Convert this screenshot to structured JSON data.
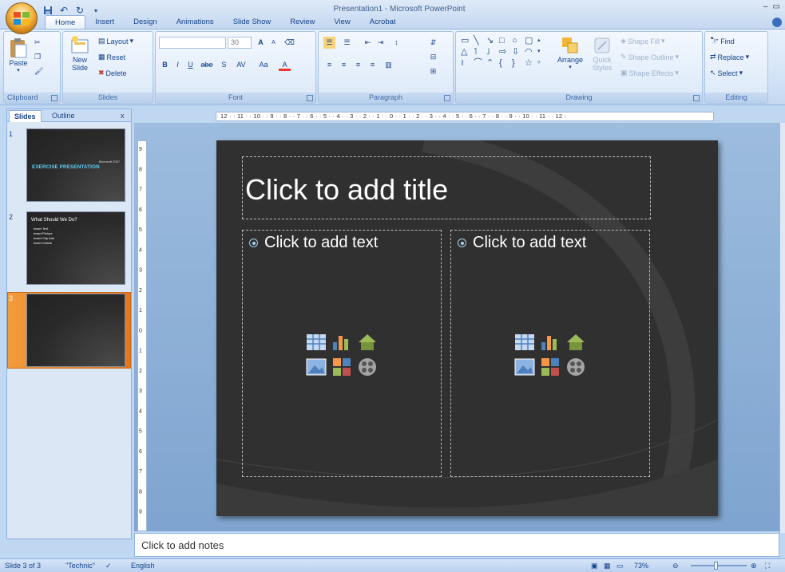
{
  "app": {
    "title": "Presentation1 - Microsoft PowerPoint"
  },
  "qat": {
    "save_icon": "save-icon",
    "undo_icon": "undo-icon",
    "redo_icon": "redo-icon",
    "customize_icon": "customize-qat-icon"
  },
  "tabs": [
    {
      "label": "Home"
    },
    {
      "label": "Insert"
    },
    {
      "label": "Design"
    },
    {
      "label": "Animations"
    },
    {
      "label": "Slide Show"
    },
    {
      "label": "Review"
    },
    {
      "label": "View"
    },
    {
      "label": "Acrobat"
    }
  ],
  "ribbon": {
    "clipboard": {
      "label": "Clipboard",
      "paste": "Paste"
    },
    "slides": {
      "label": "Slides",
      "new_slide": "New Slide",
      "new_slide_line1": "New",
      "new_slide_line2": "Slide",
      "layout": "Layout",
      "reset": "Reset",
      "delete": "Delete"
    },
    "font": {
      "label": "Font",
      "size": "30",
      "grow": "A",
      "shrink": "A",
      "bold": "B",
      "italic": "I",
      "underline": "U",
      "strike": "abe",
      "shadow": "S",
      "spacing": "AV",
      "case": "Aa",
      "color": "A"
    },
    "paragraph": {
      "label": "Paragraph"
    },
    "drawing": {
      "label": "Drawing",
      "arrange": "Arrange",
      "quick_styles": "Quick Styles",
      "quick_line1": "Quick",
      "quick_line2": "Styles",
      "shape_fill": "Shape Fill",
      "shape_outline": "Shape Outline",
      "shape_effects": "Shape Effects"
    },
    "editing": {
      "label": "Editing",
      "find": "Find",
      "replace": "Replace",
      "select": "Select"
    }
  },
  "left_pane": {
    "tabs": [
      {
        "label": "Slides"
      },
      {
        "label": "Outline"
      }
    ],
    "close": "x",
    "slides": [
      {
        "number": "1",
        "title": "EXERCISE PRESENTATION",
        "subtitle": "Microsoft 2007"
      },
      {
        "number": "2",
        "title": "What Should We Do?",
        "bullets": [
          "Insert Text",
          "Insert Picture",
          "Insert Clip Arts",
          "Insert Charts"
        ]
      },
      {
        "number": "3",
        "title": ""
      }
    ]
  },
  "ruler": {
    "horizontal": "· 12 · · 11 · · 10 · · 9 · · 8 · · 7 · · 6 · · 5 · · 4 · · 3 · · 2 · · 1 · · 0 · · 1 · · 2 · · 3 · · 4 · · 5 · · 6 · · 7 · · 8 · · 9 · · 10 · · 11 · · 12 ·",
    "vertical_ticks": [
      "9",
      "8",
      "7",
      "6",
      "5",
      "4",
      "3",
      "2",
      "1",
      "0",
      "1",
      "2",
      "3",
      "4",
      "5",
      "6",
      "7",
      "8",
      "9"
    ]
  },
  "slide": {
    "title_placeholder": "Click to add title",
    "left_placeholder": "Click to add text",
    "right_placeholder": "Click to add text"
  },
  "notes": {
    "placeholder": "Click to add notes"
  },
  "status": {
    "slide": "Slide 3 of 3",
    "theme": "\"Technic\"",
    "language": "English",
    "zoom": "73%"
  },
  "colors": {
    "slide_bg": "#303030",
    "accent_bullet": "#9fd5ec",
    "selected_thumb": "#e8761c"
  }
}
